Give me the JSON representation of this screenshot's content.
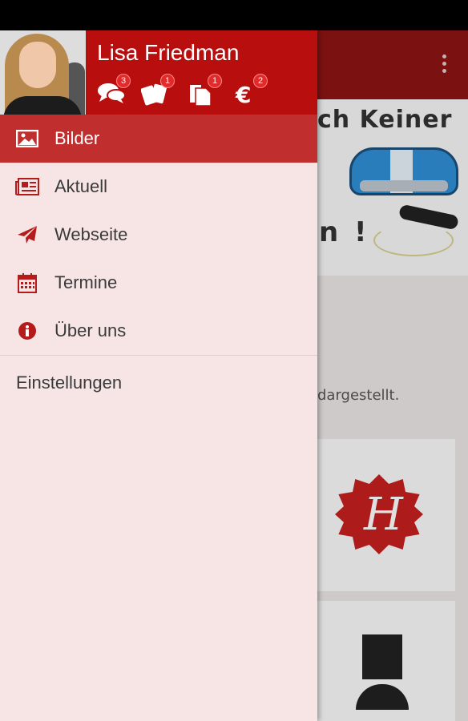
{
  "user": {
    "name": "Lisa Friedman"
  },
  "header_icons": [
    {
      "icon": "chat-bubbles-icon",
      "badge": "3"
    },
    {
      "icon": "tickets-icon",
      "badge": "1"
    },
    {
      "icon": "documents-icon",
      "badge": "1"
    },
    {
      "icon": "euro-icon",
      "badge": "2"
    }
  ],
  "menu": {
    "items": [
      {
        "label": "Bilder",
        "icon": "image-icon",
        "active": true
      },
      {
        "label": "Aktuell",
        "icon": "newspaper-icon",
        "active": false
      },
      {
        "label": "Webseite",
        "icon": "paper-plane-icon",
        "active": false
      },
      {
        "label": "Termine",
        "icon": "calendar-icon",
        "active": false
      },
      {
        "label": "Über uns",
        "icon": "info-icon",
        "active": false
      }
    ],
    "settings_label": "Einstellungen"
  },
  "background": {
    "banner_top": "ch Keiner",
    "banner_bottom": "n !",
    "body_text": "dargestellt.",
    "badge_letter": "H"
  },
  "colors": {
    "accent": "#b80e0e",
    "active_item": "#c12e2e",
    "drawer_bg": "#f7e5e5",
    "toolbar": "#8e1414"
  }
}
